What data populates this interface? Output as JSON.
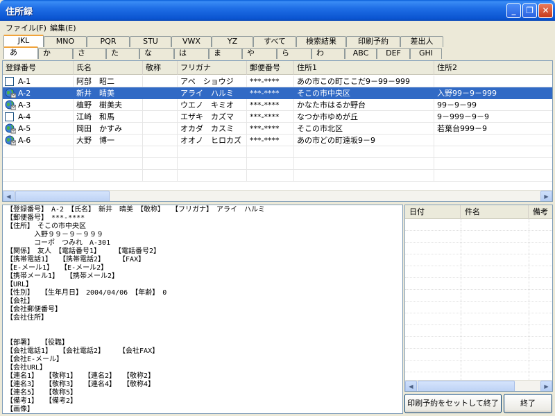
{
  "window": {
    "title": "住所録"
  },
  "menu": [
    "ファイル(F)",
    "編集(E)"
  ],
  "tabs_row1": [
    "JKL",
    "MNO",
    "PQR",
    "STU",
    "VWX",
    "YZ",
    "すべて",
    "検索結果",
    "印刷予約",
    "差出人"
  ],
  "tabs_row2": [
    "あ",
    "か",
    "さ",
    "た",
    "な",
    "は",
    "ま",
    "や",
    "ら",
    "わ",
    "ABC",
    "DEF",
    "GHI"
  ],
  "selected_tab_row1": "JKL",
  "selected_tab_row2": "あ",
  "grid": {
    "columns": [
      "登録番号",
      "氏名",
      "敬称",
      "フリガナ",
      "郵便番号",
      "住所1",
      "住所2"
    ],
    "rows": [
      {
        "icon": "checkbox-icon",
        "id": "A-1",
        "name": "阿部　昭二",
        "honorific": "",
        "kana": "アベ　ショウジ",
        "zip": "***-****",
        "addr1": "あの市この町ここだ9－99－999",
        "addr2": "",
        "selected": false
      },
      {
        "icon": "globe-icon",
        "id": "A-2",
        "name": "新井　晴美",
        "honorific": "",
        "kana": "アライ　ハルミ",
        "zip": "***-****",
        "addr1": "そこの市中央区",
        "addr2": "入野99－9－999",
        "selected": true
      },
      {
        "icon": "globe-icon",
        "id": "A-3",
        "name": "植野　樹美夫",
        "honorific": "",
        "kana": "ウエノ　キミオ",
        "zip": "***-****",
        "addr1": "かなた市はるか野台",
        "addr2": "99－9－99",
        "selected": false
      },
      {
        "icon": "checkbox-icon",
        "id": "A-4",
        "name": "江崎　和馬",
        "honorific": "",
        "kana": "エザキ　カズマ",
        "zip": "***-****",
        "addr1": "なつか市ゆめが丘",
        "addr2": "9－999－9－9",
        "selected": false
      },
      {
        "icon": "globe-icon",
        "id": "A-5",
        "name": "岡田　かすみ",
        "honorific": "",
        "kana": "オカダ　カスミ",
        "zip": "***-****",
        "addr1": "そこの市北区",
        "addr2": "若葉台999－9",
        "selected": false
      },
      {
        "icon": "globe-icon",
        "id": "A-6",
        "name": "大野　博一",
        "honorific": "",
        "kana": "オオノ　ヒロカズ",
        "zip": "***-****",
        "addr1": "あの市どの町遠坂9－9",
        "addr2": "",
        "selected": false
      }
    ]
  },
  "detail": {
    "lines": [
      "【登録番号】　A-2　【氏名】　新井　晴美　【敬称】　　【フリガナ】　アライ　ハルミ",
      "【郵便番号】　***-****",
      "【住所】　そこの市中央区",
      "　　　　入野９９－９－９９９",
      "　　　　コーポ　つみれ　A-301",
      "【関係】　友人　【電話番号1】　　　【電話番号2】",
      "【携帯電話1】　　【携帯電話2】　　　【FAX】",
      "【E-メール1】　　【E-メール2】",
      "【携帯メール1】　　【携帯メール2】",
      "【URL】",
      "【性別】　　【生年月日】　2004/04/06　【年齢】　0",
      "【会社】",
      "【会社郵便番号】",
      "【会社住所】",
      "",
      "",
      "【部署】　　【役職】",
      "【会社電話1】　　【会社電話2】　　　【会社FAX】",
      "【会社E-メール】",
      "【会社URL】",
      "【連名1】　　【敬称1】　　【連名2】　　【敬称2】",
      "【連名3】　　【敬称3】　　【連名4】　　【敬称4】",
      "【連名5】　　【敬称5】",
      "【備考1】　　【備考2】",
      "【画像】"
    ]
  },
  "rightlist": {
    "columns": [
      "日付",
      "件名",
      "備考"
    ]
  },
  "buttons": {
    "print_end": "印刷予約をセットして終了",
    "end": "終了"
  }
}
